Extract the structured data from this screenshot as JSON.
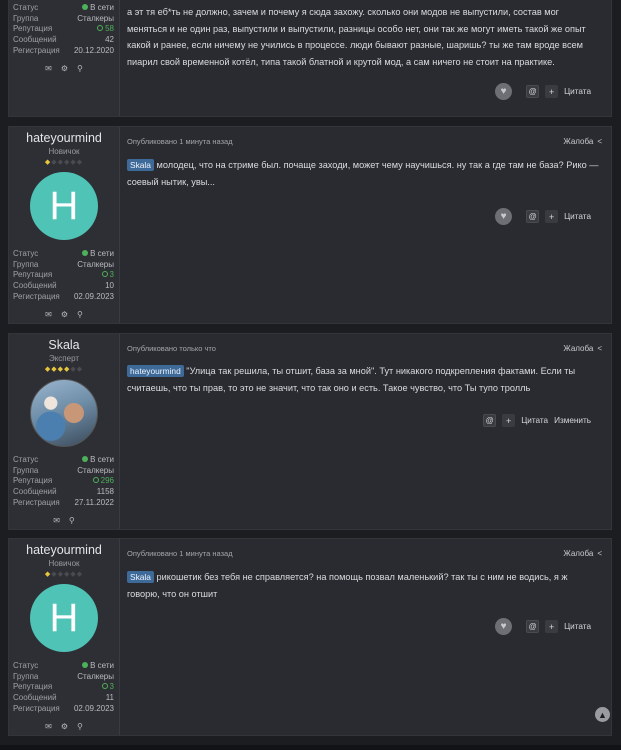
{
  "labels": {
    "status": "Статус",
    "group": "Группа",
    "reputation": "Репутация",
    "messages": "Сообщений",
    "registration": "Регистрация",
    "report": "Жалоба",
    "quote": "Цитата",
    "edit": "Изменить"
  },
  "posts": [
    {
      "status": "В сети",
      "group": "Сталкеры",
      "reputation": "58",
      "messages": "42",
      "registration": "20.12.2020",
      "text": "а эт тя еб*ть не должно, зачем и почему я сюда захожу. сколько они модов не выпустили, состав мог меняться и не один раз, выпустили и выпустили, разницы особо нет, они так же могут иметь такой же опыт какой и ранее, если ничему не учились в процессе. люди бывают разные, шаришь? ты же там вроде всем пиарил свой временной котёл, типа такой блатной и крутой мод, а сам ничего не стоит на практике."
    },
    {
      "name": "hateyourmind",
      "rank": "Новичок",
      "avatar_letter": "H",
      "status": "В сети",
      "group": "Сталкеры",
      "reputation": "3",
      "messages": "10",
      "registration": "02.09.2023",
      "meta": "Опубликовано 1 минута назад",
      "mention": "Skala",
      "text": " молодец, что на стриме был. почаще заходи, может чему научишься. ну так а где там не база? Рико — соевый нытик, увы..."
    },
    {
      "name": "Skala",
      "rank": "Эксперт",
      "status": "В сети",
      "group": "Сталкеры",
      "reputation": "296",
      "messages": "1158",
      "registration": "27.11.2022",
      "meta": "Опубликовано только что",
      "mention": "hateyourmind",
      "text": " \"Улица так решила, ты отшит, база за мной\". Тут никакого подкрепления фактами. Если ты считаешь, что ты прав, то это не значит, что так оно и есть. Такое чувство, что Ты тупо тролль"
    },
    {
      "name": "hateyourmind",
      "rank": "Новичок",
      "avatar_letter": "H",
      "status": "В сети",
      "group": "Сталкеры",
      "reputation": "3",
      "messages": "11",
      "registration": "02.09.2023",
      "meta": "Опубликовано 1 минута назад",
      "mention": "Skala",
      "text": " рикошетик без тебя не справляется? на помощь позвал маленький? так ты с ним не водись, я ж говорю, что он отшит"
    }
  ]
}
